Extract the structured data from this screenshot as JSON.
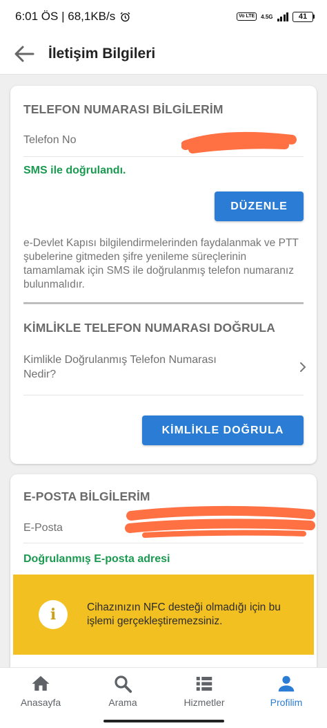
{
  "status_bar": {
    "left_text": "6:01 ÖS | 68,1KB/s",
    "volte": "Vo LTE",
    "network": "4.5G",
    "battery": "41"
  },
  "header": {
    "title": "İletişim Bilgileri"
  },
  "phone_section": {
    "title": "TELEFON NUMARASI BİLGİLERİM",
    "phone_label": "Telefon No",
    "verified_text": "SMS ile doğrulandı.",
    "edit_button": "DÜZENLE",
    "description": "e-Devlet Kapısı bilgilendirmelerinden faydalanmak ve PTT şubelerine gitmeden şifre yenileme süreçlerinin tamamlamak için SMS ile doğrulanmış telefon numaranız bulunmalıdır."
  },
  "identity_section": {
    "title": "KİMLİKLE TELEFON NUMARASI DOĞRULA",
    "faq_link": "Kimlikle Doğrulanmış Telefon Numarası Nedir?",
    "verify_button": "KİMLİKLE DOĞRULA"
  },
  "email_section": {
    "title": "E-POSTA BİLGİLERİM",
    "email_label": "E-Posta",
    "verified_text": "Doğrulanmış E-posta adresi"
  },
  "warning": {
    "text": "Cihazınızın NFC desteği olmadığı için bu işlemi gerçekleştiremezsiniz."
  },
  "bottom_nav": {
    "items": [
      {
        "label": "Anasayfa",
        "icon": "home-icon"
      },
      {
        "label": "Arama",
        "icon": "search-icon"
      },
      {
        "label": "Hizmetler",
        "icon": "list-icon"
      },
      {
        "label": "Profilim",
        "icon": "person-icon"
      }
    ],
    "active_index": 3
  },
  "colors": {
    "accent": "#2a7cd4",
    "success": "#1a9a50",
    "warning_bg": "#f3c021",
    "redaction": "#ff7043"
  }
}
